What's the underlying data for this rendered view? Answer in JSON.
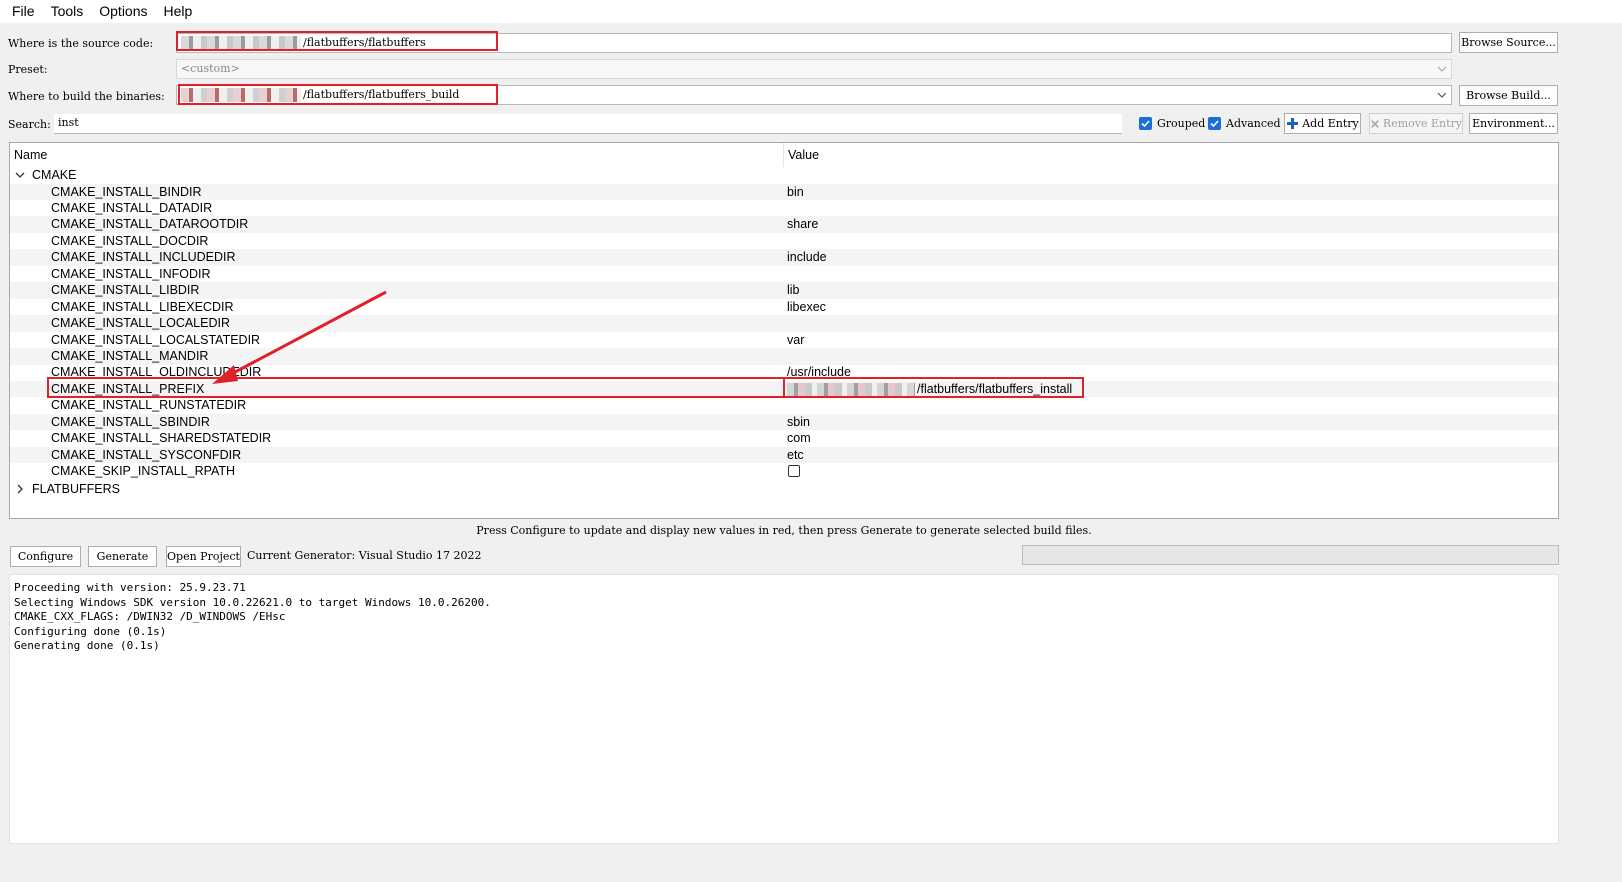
{
  "menu": [
    "File",
    "Tools",
    "Options",
    "Help"
  ],
  "source": {
    "label": "Where is the source code:",
    "value": "/flatbuffers/flatbuffers",
    "button": "Browse Source..."
  },
  "preset": {
    "label": "Preset:",
    "value": "<custom>"
  },
  "build": {
    "label": "Where to build the binaries:",
    "value": "/flatbuffers/flatbuffers_build",
    "button": "Browse Build..."
  },
  "search": {
    "label": "Search:",
    "value": "inst"
  },
  "options": {
    "grouped": "Grouped",
    "advanced": "Advanced",
    "add_entry": "Add Entry",
    "remove_entry": "Remove Entry",
    "environment": "Environment..."
  },
  "table": {
    "col_name": "Name",
    "col_value": "Value",
    "groups": [
      "CMAKE",
      "FLATBUFFERS"
    ],
    "rows": [
      {
        "name": "CMAKE_INSTALL_BINDIR",
        "value": "bin"
      },
      {
        "name": "CMAKE_INSTALL_DATADIR",
        "value": ""
      },
      {
        "name": "CMAKE_INSTALL_DATAROOTDIR",
        "value": "share"
      },
      {
        "name": "CMAKE_INSTALL_DOCDIR",
        "value": ""
      },
      {
        "name": "CMAKE_INSTALL_INCLUDEDIR",
        "value": "include"
      },
      {
        "name": "CMAKE_INSTALL_INFODIR",
        "value": ""
      },
      {
        "name": "CMAKE_INSTALL_LIBDIR",
        "value": "lib"
      },
      {
        "name": "CMAKE_INSTALL_LIBEXECDIR",
        "value": "libexec"
      },
      {
        "name": "CMAKE_INSTALL_LOCALEDIR",
        "value": ""
      },
      {
        "name": "CMAKE_INSTALL_LOCALSTATEDIR",
        "value": "var"
      },
      {
        "name": "CMAKE_INSTALL_MANDIR",
        "value": ""
      },
      {
        "name": "CMAKE_INSTALL_OLDINCLUDEDIR",
        "value": "/usr/include"
      },
      {
        "name": "CMAKE_INSTALL_PREFIX",
        "value": "/flatbuffers/flatbuffers_install"
      },
      {
        "name": "CMAKE_INSTALL_RUNSTATEDIR",
        "value": ""
      },
      {
        "name": "CMAKE_INSTALL_SBINDIR",
        "value": "sbin"
      },
      {
        "name": "CMAKE_INSTALL_SHAREDSTATEDIR",
        "value": "com"
      },
      {
        "name": "CMAKE_INSTALL_SYSCONFDIR",
        "value": "etc"
      },
      {
        "name": "CMAKE_SKIP_INSTALL_RPATH",
        "value": ""
      }
    ]
  },
  "hint": "Press Configure to update and display new values in red, then press Generate to generate selected build files.",
  "actions": {
    "configure": "Configure",
    "generate": "Generate",
    "open_project": "Open Project",
    "generator": "Current Generator: Visual Studio 17 2022"
  },
  "output": [
    "Proceeding with version: 25.9.23.71",
    "Selecting Windows SDK version 10.0.22621.0 to target Windows 10.0.26200.",
    "CMAKE_CXX_FLAGS: /DWIN32 /D_WINDOWS /EHsc",
    "Configuring done (0.1s)",
    "Generating done (0.1s)"
  ],
  "colors": {
    "highlight": "#e0202a",
    "checkbox": "#1c6fd6"
  }
}
